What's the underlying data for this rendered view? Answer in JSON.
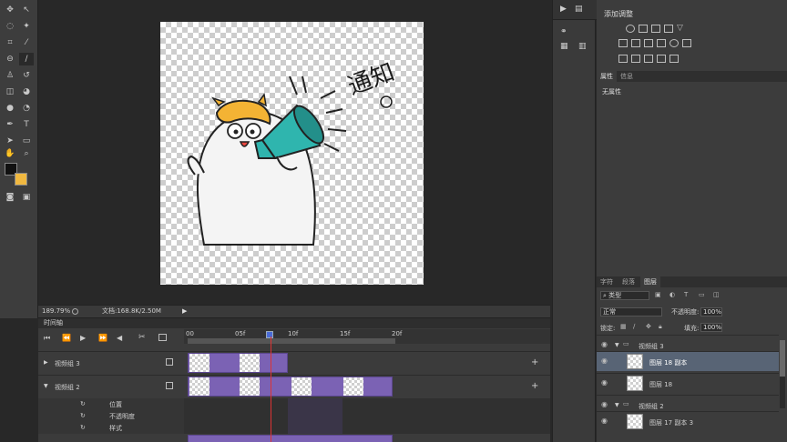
{
  "statusbar": {
    "zoom": "189.79%",
    "doc": "文档:168.8K/2.50M"
  },
  "timeline": {
    "tab": "时间轴",
    "ruler": [
      "00",
      "05f",
      "10f",
      "15f",
      "20f"
    ],
    "groups": [
      {
        "name": "视频组 3",
        "expanded": false
      },
      {
        "name": "视频组 2",
        "expanded": true
      }
    ],
    "props": [
      "位置",
      "不透明度",
      "样式"
    ],
    "clip_color": "#7b62b4",
    "playhead_color": "#d33"
  },
  "adjustments": {
    "title": "添加调整"
  },
  "properties": {
    "tabs": [
      "属性",
      "信息"
    ],
    "empty": "无属性"
  },
  "layers": {
    "tabs": [
      "字符",
      "段落",
      "图层"
    ],
    "filter": "类型",
    "blend_mode": "正常",
    "opacity_label": "不透明度:",
    "opacity_value": "100%",
    "lock_label": "锁定:",
    "fill_label": "填充:",
    "fill_value": "100%",
    "items": [
      {
        "kind": "group",
        "name": "视频组 3"
      },
      {
        "kind": "layer",
        "name": "图层 18 副本",
        "selected": true
      },
      {
        "kind": "layer",
        "name": "图层 18",
        "selected": false
      },
      {
        "kind": "group",
        "name": "视频组 2"
      },
      {
        "kind": "layer",
        "name": "图层 17 副本 3",
        "selected": false
      }
    ]
  },
  "artwork": {
    "text": "通知"
  }
}
